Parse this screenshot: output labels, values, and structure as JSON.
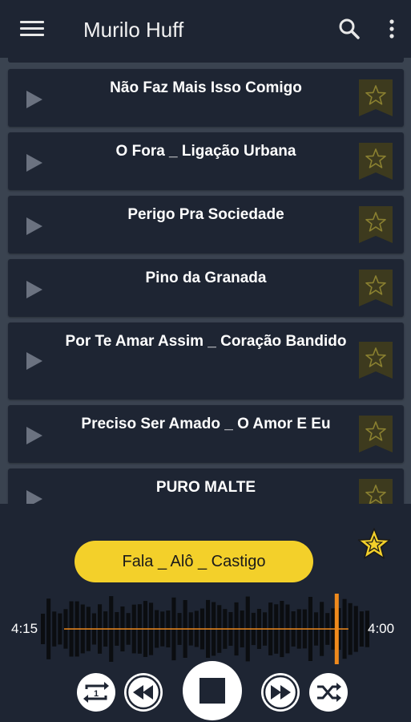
{
  "appbar": {
    "title": "Murilo Huff",
    "menu_icon": "hamburger-menu-icon",
    "search_icon": "search-icon",
    "more_icon": "more-vertical-icon"
  },
  "songs": [
    {
      "title": "Não Faz Mais Isso Comigo"
    },
    {
      "title": "O Fora _ Ligação Urbana"
    },
    {
      "title": "Perigo Pra Sociedade"
    },
    {
      "title": "Pino da Granada"
    },
    {
      "title": "Por Te Amar Assim _ Coração Bandido"
    },
    {
      "title": "Preciso Ser Amado _ O Amor E Eu"
    },
    {
      "title": "PURO MALTE"
    }
  ],
  "player": {
    "now_playing": "Fala _ Alô _ Castigo",
    "elapsed": "4:15",
    "duration": "4:00",
    "progress_fraction": 0.9,
    "favorite_icon": "star-icon",
    "controls": [
      "repeat-one-icon",
      "rewind-icon",
      "stop-icon",
      "fast-forward-icon",
      "shuffle-icon"
    ]
  },
  "colors": {
    "background": "#3a4350",
    "card": "#1e2533",
    "accent": "#f3d02a",
    "progress": "#f08a1c",
    "fav_button": "#3d3a1e"
  }
}
